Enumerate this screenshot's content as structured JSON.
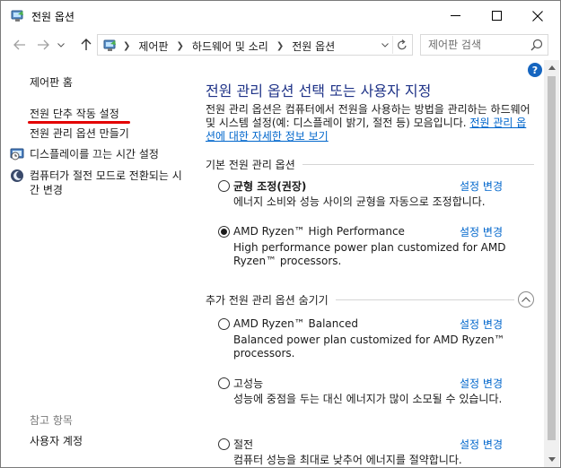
{
  "window": {
    "title": "전원 옵션"
  },
  "nav": {
    "breadcrumbs": [
      "제어판",
      "하드웨어 및 소리",
      "전원 옵션"
    ],
    "search_placeholder": "제어판 검색"
  },
  "help": {
    "label": "?"
  },
  "sidebar": {
    "home": "제어판 홈",
    "wake_settings": "전원 단추 작동 설정",
    "create_plan": "전원 관리 옵션 만들기",
    "display_off": "디스플레이를 끄는 시간 설정",
    "sleep_time": "컴퓨터가 절전 모드로 전환되는 시간 변경",
    "see_also": "참고 항목",
    "user_accounts": "사용자 계정"
  },
  "main": {
    "title": "전원 관리 옵션 선택 또는 사용자 지정",
    "description": "전원 관리 옵션은 컴퓨터에서 전원을 사용하는 방법을 관리하는 하드웨어 및 시스템 설정(예: 디스플레이 밝기, 절전 등) 모음입니다. ",
    "learn_more": "전원 관리 옵션에 대한 자세한 정보 보기",
    "preferred_heading": "기본 전원 관리 옵션",
    "additional_heading": "추가 전원 관리 옵션 숨기기",
    "change_label": "설정 변경",
    "plans": [
      {
        "name": "균형 조정(권장)",
        "description": "에너지 소비와 성능 사이의 균형을 자동으로 조정합니다.",
        "selected": false
      },
      {
        "name": "AMD Ryzen™ High Performance",
        "description": "High performance power plan customized for AMD Ryzen™ processors.",
        "selected": true
      },
      {
        "name": "AMD Ryzen™ Balanced",
        "description": "Balanced power plan customized for AMD Ryzen™ processors.",
        "selected": false
      },
      {
        "name": "고성능",
        "description": "성능에 중점을 두는 대신 에너지가 많이 소모될 수 있습니다.",
        "selected": false
      },
      {
        "name": "절전",
        "description": "컴퓨터 성능을 최대로 낮추어 에너지를 절약합니다.",
        "selected": false
      }
    ]
  },
  "colors": {
    "title_blue": "#1e3287",
    "link_blue": "#0066cc",
    "annotation_red": "#e30000"
  }
}
